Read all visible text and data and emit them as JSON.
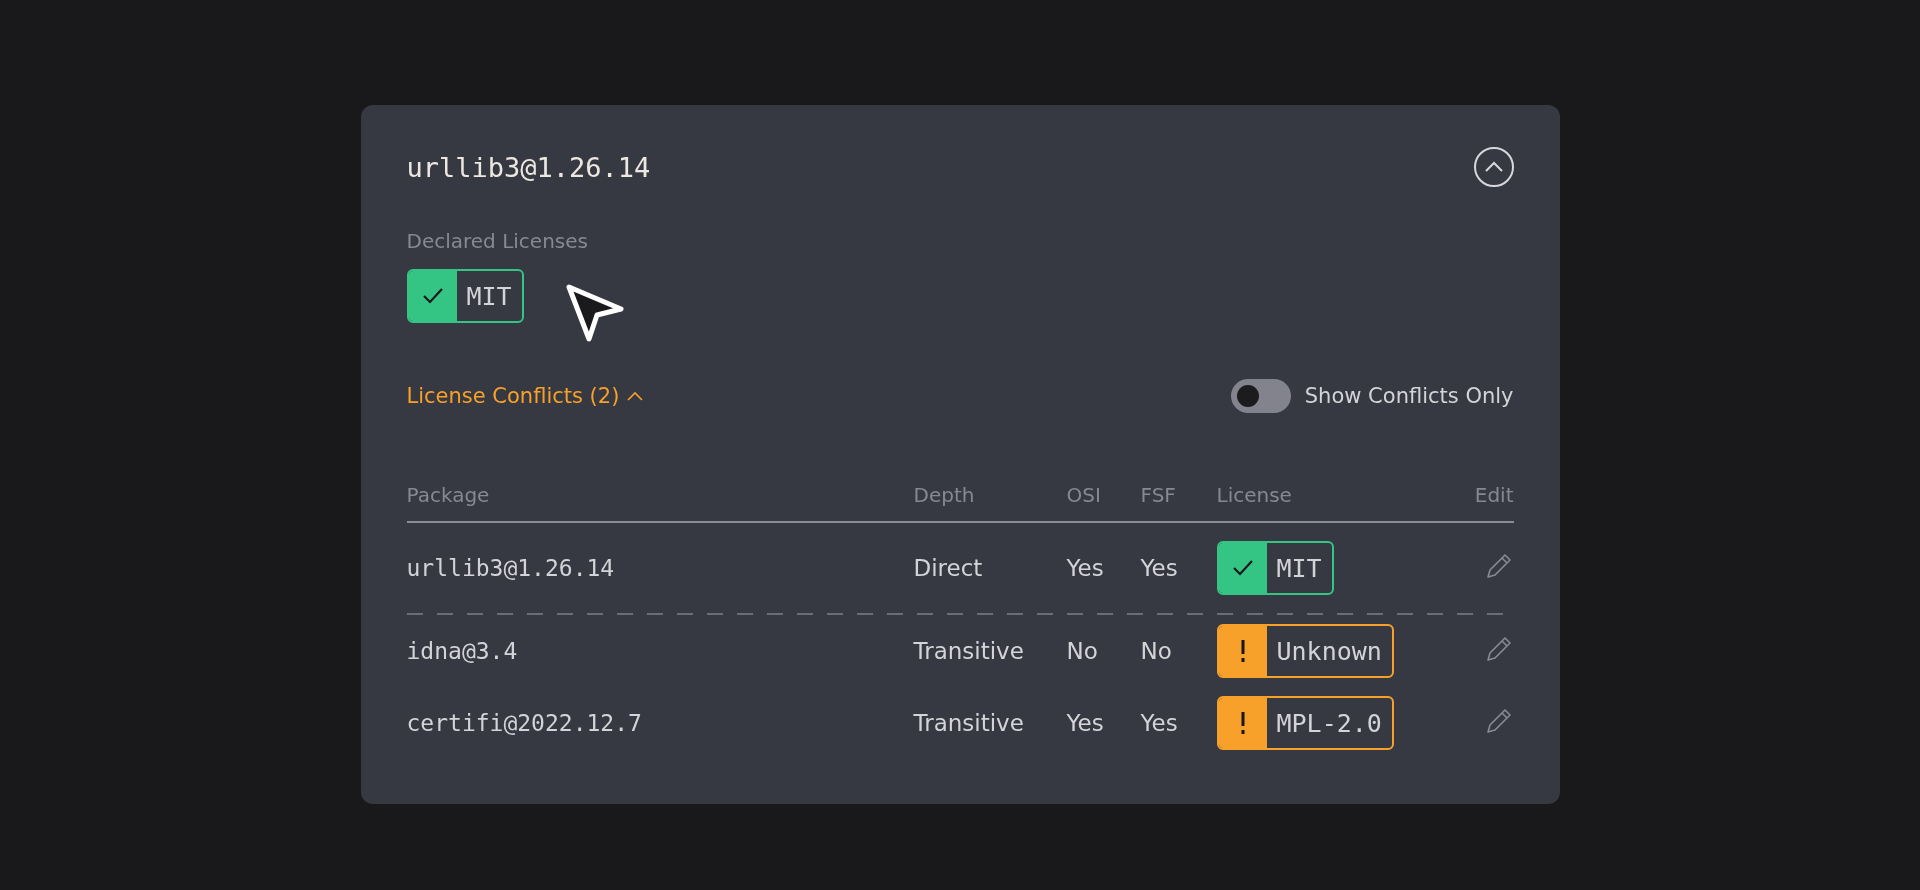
{
  "package": {
    "name": "urllib3@1.26.14",
    "expanded": true
  },
  "declared": {
    "label": "Declared Licenses",
    "licenses": [
      {
        "name": "MIT",
        "kind": "ok"
      }
    ]
  },
  "conflicts": {
    "label": "License Conflicts (2)",
    "expanded": true
  },
  "filter": {
    "label": "Show Conflicts Only",
    "on": false
  },
  "table": {
    "columns": [
      "Package",
      "Depth",
      "OSI",
      "FSF",
      "License",
      "Edit"
    ],
    "rows": [
      {
        "package": "urllib3@1.26.14",
        "depth": "Direct",
        "osi": "Yes",
        "fsf": "Yes",
        "license": "MIT",
        "kind": "ok"
      },
      {
        "package": "idna@3.4",
        "depth": "Transitive",
        "osi": "No",
        "fsf": "No",
        "license": "Unknown",
        "kind": "warning"
      },
      {
        "package": "certifi@2022.12.7",
        "depth": "Transitive",
        "osi": "Yes",
        "fsf": "Yes",
        "license": "MPL-2.0",
        "kind": "warning"
      }
    ]
  }
}
